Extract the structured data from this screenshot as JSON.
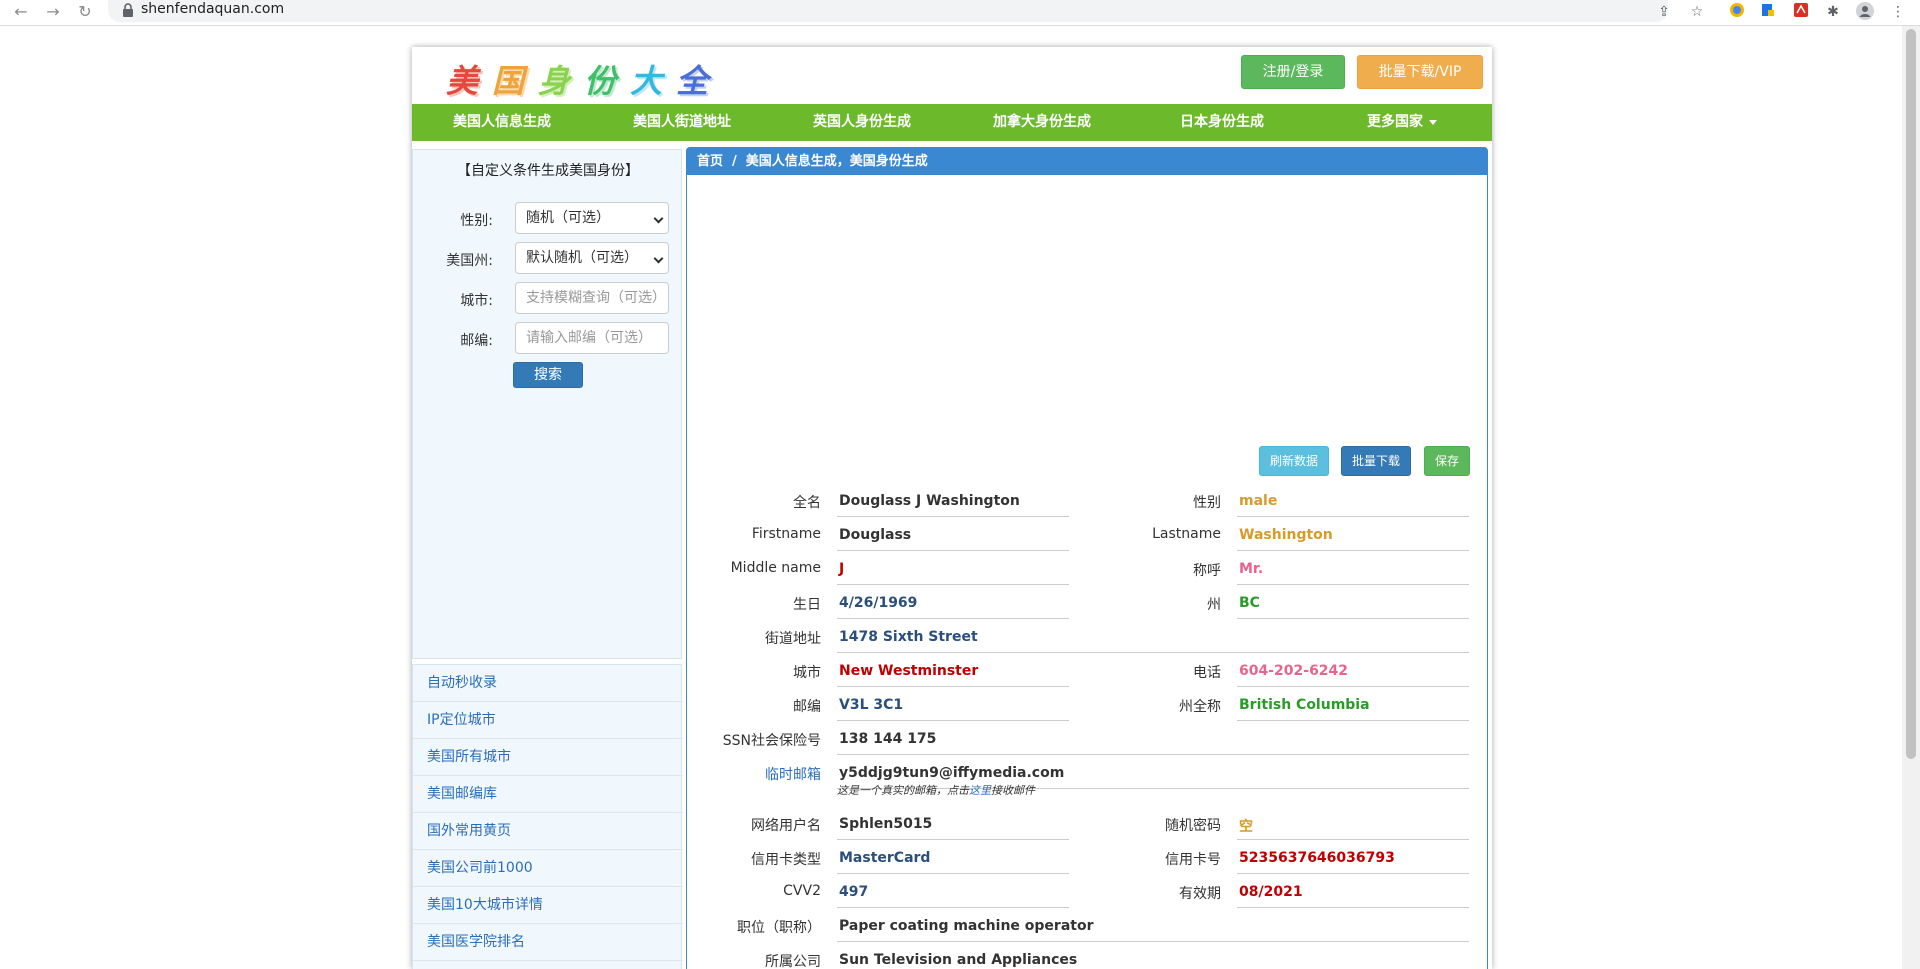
{
  "browser": {
    "url": "shenfendaquan.com"
  },
  "site": {
    "logo": [
      "美",
      "国",
      "身",
      "份",
      "大",
      "全"
    ],
    "login_button": "注册/登录",
    "vip_button": "批量下载/VIP"
  },
  "nav": {
    "items": [
      "美国人信息生成",
      "美国人街道地址",
      "英国人身份生成",
      "加拿大身份生成",
      "日本身份生成",
      "更多国家"
    ]
  },
  "sidebar": {
    "title": "【自定义条件生成美国身份】",
    "gender_label": "性别:",
    "gender_value": "随机（可选）",
    "state_label": "美国州:",
    "state_value": "默认随机（可选）",
    "city_label": "城市:",
    "city_placeholder": "支持模糊查询（可选）",
    "zip_label": "邮编:",
    "zip_placeholder": "请输入邮编（可选）",
    "search_button": "搜索",
    "links": [
      "自动秒收录",
      "IP定位城市",
      "美国所有城市",
      "美国邮编库",
      "国外常用黄页",
      "美国公司前1000",
      "美国10大城市详情",
      "美国医学院排名"
    ]
  },
  "main": {
    "breadcrumb_home": "首页",
    "breadcrumb_sep": "/",
    "breadcrumb_current": "美国人信息生成，美国身份生成",
    "refresh_button": "刷新数据",
    "batch_button": "批量下载",
    "save_button": "保存",
    "fields": {
      "fullname": {
        "label": "全名",
        "value": "Douglass J Washington"
      },
      "gender": {
        "label": "性别",
        "value": "male"
      },
      "firstname": {
        "label": "Firstname",
        "value": "Douglass"
      },
      "lastname": {
        "label": "Lastname",
        "value": "Washington"
      },
      "middlename": {
        "label": "Middle name",
        "value": "J"
      },
      "title": {
        "label": "称呼",
        "value": "Mr."
      },
      "birthday": {
        "label": "生日",
        "value": "4/26/1969"
      },
      "state": {
        "label": "州",
        "value": "BC"
      },
      "street": {
        "label": "街道地址",
        "value": "1478 Sixth Street"
      },
      "city": {
        "label": "城市",
        "value": "New Westminster"
      },
      "phone": {
        "label": "电话",
        "value": "604-202-6242"
      },
      "zip": {
        "label": "邮编",
        "value": "V3L 3C1"
      },
      "state_full": {
        "label": "州全称",
        "value": "British Columbia"
      },
      "ssn": {
        "label": "SSN社会保险号",
        "value": "138 144 175"
      },
      "email": {
        "label": "临时邮箱",
        "value": "y5ddjg9tun9@iffymedia.com"
      },
      "username": {
        "label": "网络用户名",
        "value": "Sphlen5015"
      },
      "password": {
        "label": "随机密码",
        "value": "空"
      },
      "card_type": {
        "label": "信用卡类型",
        "value": "MasterCard"
      },
      "card_number": {
        "label": "信用卡号",
        "value": "5235637646036793"
      },
      "cvv2": {
        "label": "CVV2",
        "value": "497"
      },
      "expiry": {
        "label": "有效期",
        "value": "08/2021"
      },
      "occupation": {
        "label": "职位（职称）",
        "value": "Paper coating machine operator"
      },
      "company": {
        "label": "所属公司",
        "value": "Sun Television and Appliances"
      }
    },
    "email_note_prefix": "这是一个真实的邮箱，点击",
    "email_note_link": "这里",
    "email_note_suffix": "接收邮件"
  }
}
